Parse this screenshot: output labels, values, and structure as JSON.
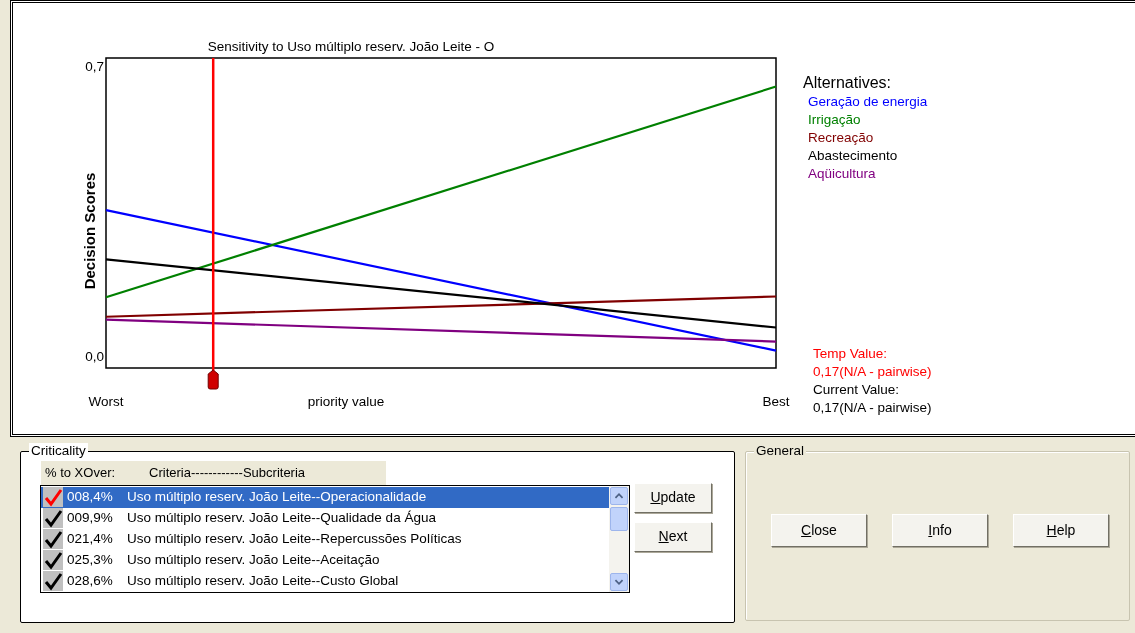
{
  "chart": {
    "chart_data": {
      "type": "line",
      "title": "Sensitivity to Uso múltiplo reserv. João Leite - O",
      "xlabel": "priority value",
      "ylabel": "Decision Scores",
      "categories": [
        "Worst",
        "Best"
      ],
      "yticks": [
        {
          "value": 0,
          "label": "0,0"
        },
        {
          "value": 0.7,
          "label": "0,7"
        }
      ],
      "ylim": [
        -0.03,
        0.72
      ],
      "series": [
        {
          "name": "Geração de energia",
          "color": "#0000ff",
          "values": [
            0.352,
            0.012
          ]
        },
        {
          "name": "Irrigação",
          "color": "#008000",
          "values": [
            0.141,
            0.651
          ]
        },
        {
          "name": "Recreação",
          "color": "#800000",
          "values": [
            0.094,
            0.143
          ]
        },
        {
          "name": "Abastecimento",
          "color": "#000000",
          "values": [
            0.233,
            0.068
          ]
        },
        {
          "name": "Aqüicultura",
          "color": "#800080",
          "values": [
            0.087,
            0.034
          ]
        }
      ]
    },
    "slider": {
      "level": 0.16
    }
  },
  "legend": {
    "title": "Alternatives:"
  },
  "values": {
    "temp_label": "Temp Value:",
    "temp_value": "0,17(N/A - pairwise)",
    "current_label": "Current Value:",
    "current_value": "0,17(N/A - pairwise)"
  },
  "criticality": {
    "title": "Criticality",
    "columns": [
      "% to XOver:",
      "Criteria------------Subcriteria"
    ],
    "rows": [
      {
        "percent": "008,4%",
        "label": "Uso múltiplo reserv. João Leite--Operacionalidade",
        "checked": true,
        "selected": true
      },
      {
        "percent": "009,9%",
        "label": "Uso múltiplo reserv. João Leite--Qualidade da Água",
        "checked": true,
        "selected": false
      },
      {
        "percent": "021,4%",
        "label": "Uso múltiplo reserv. João Leite--Repercussões Políticas",
        "checked": true,
        "selected": false
      },
      {
        "percent": "025,3%",
        "label": "Uso múltiplo reserv. João Leite--Aceitação",
        "checked": true,
        "selected": false
      },
      {
        "percent": "028,6%",
        "label": "Uso múltiplo reserv. João Leite--Custo Global",
        "checked": true,
        "selected": false
      }
    ],
    "buttons": [
      "Update",
      "Next"
    ]
  },
  "general": {
    "title": "General",
    "buttons": [
      "Close",
      "Info",
      "Help"
    ]
  }
}
